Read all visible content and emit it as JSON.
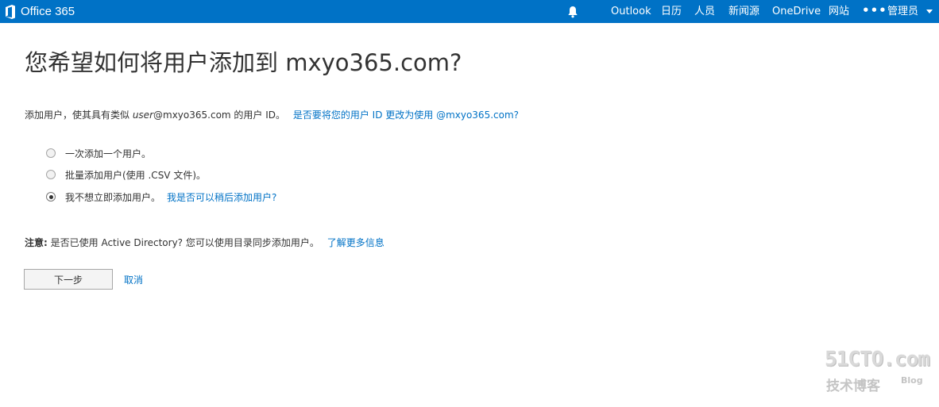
{
  "header": {
    "brand": "Office 365",
    "nav": [
      "Outlook",
      "日历",
      "人员",
      "新闻源",
      "OneDrive",
      "网站"
    ],
    "more": "•••",
    "user": "管理员",
    "icons": {
      "logo": "office-logo-icon",
      "notifications": "bell-icon",
      "user_menu": "chevron-down-icon"
    },
    "colors": {
      "bar": "#0072c6",
      "text": "#ffffff"
    }
  },
  "page": {
    "title": "您希望如何将用户添加到 mxyo365.com?",
    "intro": {
      "text_before": "添加用户，使其具有类似 ",
      "example_user": "user",
      "example_domain": "@mxyo365.com 的用户 ID。",
      "link": "是否要将您的用户 ID 更改为使用 @mxyo365.com?"
    },
    "options": [
      {
        "label": "一次添加一个用户。",
        "selected": false,
        "link": ""
      },
      {
        "label": "批量添加用户(使用 .CSV 文件)。",
        "selected": false,
        "link": ""
      },
      {
        "label": "我不想立即添加用户。",
        "selected": true,
        "link": "我是否可以稍后添加用户?"
      }
    ],
    "note": {
      "label": "注意:",
      "text": " 是否已使用 Active Directory? 您可以使用目录同步添加用户。",
      "link": "了解更多信息"
    },
    "buttons": {
      "next": "下一步",
      "cancel": "取消"
    },
    "colors": {
      "link": "#0072c6",
      "text": "#333333"
    }
  },
  "watermark": {
    "main": "51CTO.com",
    "sub": "技术博客",
    "blog": "Blog"
  }
}
